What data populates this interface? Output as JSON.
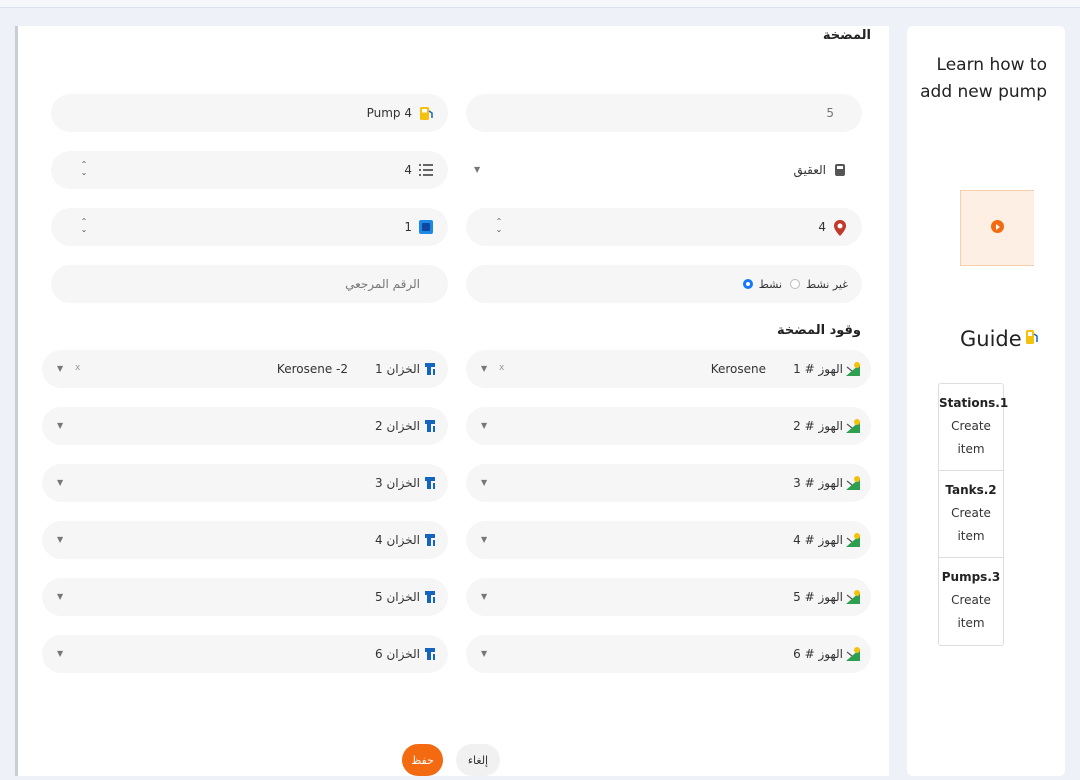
{
  "form": {
    "section_pump": "المضخة",
    "name_value": "Pump 4",
    "number_value": "5",
    "count_value": "4",
    "station_value": "العقيق",
    "tank_count_value": "1",
    "location_value": "4",
    "reference_placeholder": "الرقم المرجعي",
    "status_active": "نشط",
    "status_inactive": "غير نشط",
    "section_fuels": "وقود المضخة",
    "nozzles": [
      {
        "label": "الهوز # 1",
        "fuel": "Kerosene",
        "clear": "x"
      },
      {
        "label": "الهوز # 2",
        "fuel": "",
        "clear": ""
      },
      {
        "label": "الهوز # 3",
        "fuel": "",
        "clear": ""
      },
      {
        "label": "الهوز # 4",
        "fuel": "",
        "clear": ""
      },
      {
        "label": "الهوز # 5",
        "fuel": "",
        "clear": ""
      },
      {
        "label": "الهوز # 6",
        "fuel": "",
        "clear": ""
      }
    ],
    "tanks": [
      {
        "label": "الخزان 1",
        "fuel": "Kerosene -2",
        "clear": "x"
      },
      {
        "label": "الخزان 2",
        "fuel": "",
        "clear": ""
      },
      {
        "label": "الخزان 3",
        "fuel": "",
        "clear": ""
      },
      {
        "label": "الخزان 4",
        "fuel": "",
        "clear": ""
      },
      {
        "label": "الخزان 5",
        "fuel": "",
        "clear": ""
      },
      {
        "label": "الخزان 6",
        "fuel": "",
        "clear": ""
      }
    ],
    "save_label": "حفظ",
    "cancel_label": "إلغاء"
  },
  "help": {
    "title": "Learn how to add new pump",
    "guide_title": "Guide",
    "steps": [
      {
        "name": "Stations.1",
        "desc": "Create item"
      },
      {
        "name": "Tanks.2",
        "desc": "Create item"
      },
      {
        "name": "Pumps.3",
        "desc": "Create item"
      }
    ]
  },
  "colors": {
    "accent": "#f36a10",
    "radio": "#1677ff",
    "location_pin": "#c0392b",
    "tank_icon": "#1565c0"
  }
}
